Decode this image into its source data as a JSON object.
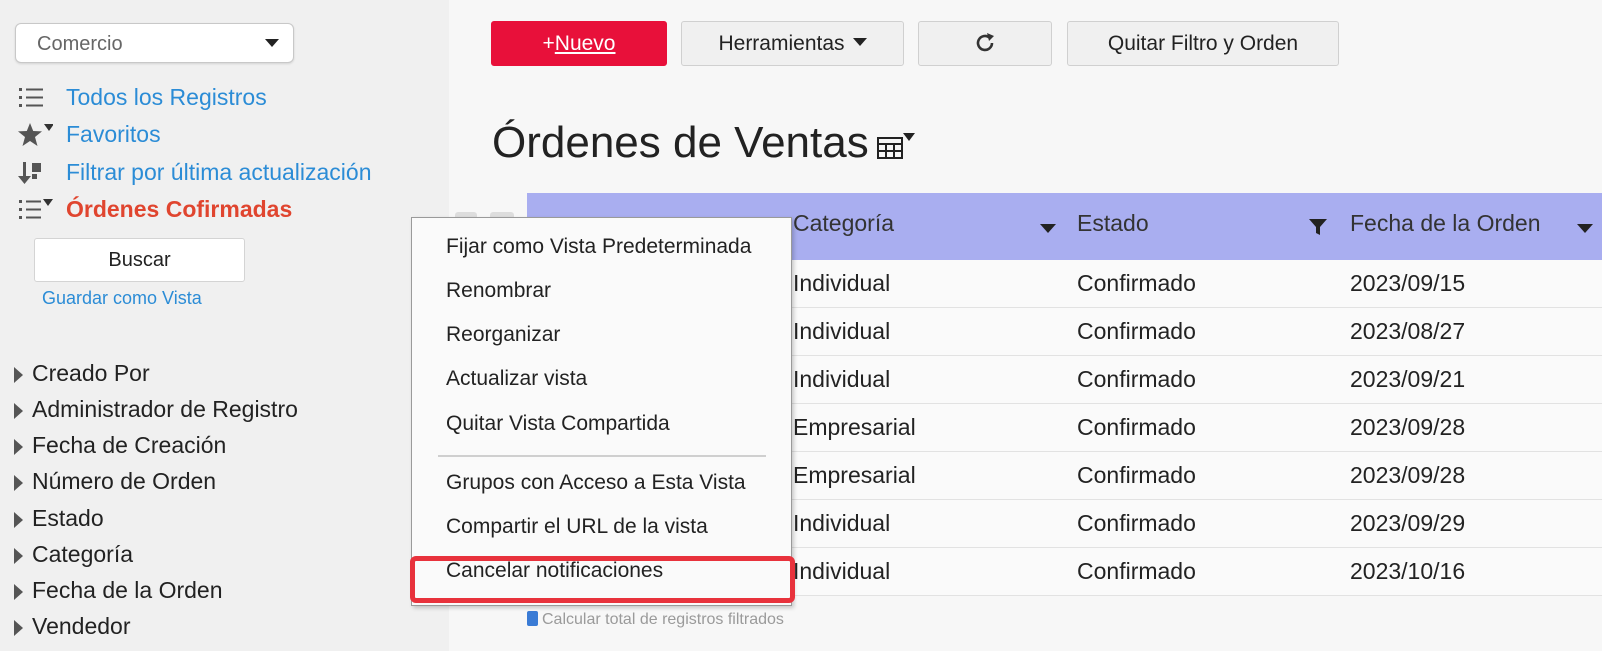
{
  "sidebar": {
    "app_select": "Comercio",
    "views": [
      {
        "label": "Todos los Registros",
        "icon": "list-icon"
      },
      {
        "label": "Favoritos",
        "icon": "star-filter-icon"
      },
      {
        "label": "Filtrar por última actualización",
        "icon": "sort-down-icon"
      },
      {
        "label": "Órdenes Cofirmadas",
        "icon": "list-filter-icon",
        "active": true
      }
    ],
    "search_label": "Buscar",
    "save_view_label": "Guardar como Vista",
    "fields": [
      "Creado Por",
      "Administrador de Registro",
      "Fecha de Creación",
      "Número de Orden",
      "Estado",
      "Categoría",
      "Fecha de la Orden",
      "Vendedor"
    ]
  },
  "toolbar": {
    "new_prefix": "+",
    "new_label": "Nuevo",
    "tools_label": "Herramientas",
    "refresh_icon": "refresh-icon",
    "clear_label": "Quitar Filtro y Orden"
  },
  "main": {
    "title": "Órdenes de Ventas",
    "view_switch_icon": "table-icon",
    "columns": [
      "Categoría",
      "Estado",
      "Fecha de la Orden"
    ],
    "rows": [
      [
        "Individual",
        "Confirmado",
        "2023/09/15"
      ],
      [
        "Individual",
        "Confirmado",
        "2023/08/27"
      ],
      [
        "Individual",
        "Confirmado",
        "2023/09/21"
      ],
      [
        "Empresarial",
        "Confirmado",
        "2023/09/28"
      ],
      [
        "Empresarial",
        "Confirmado",
        "2023/09/28"
      ],
      [
        "Individual",
        "Confirmado",
        "2023/09/29"
      ],
      [
        "Individual",
        "Confirmado",
        "2023/10/16"
      ]
    ],
    "calc_label": "Calcular total de registros filtrados"
  },
  "context_menu": {
    "items": [
      "Fijar como Vista Predeterminada",
      "Renombrar",
      "Reorganizar",
      "Actualizar vista",
      "Quitar Vista Compartida",
      "Grupos con Acceso a Esta Vista",
      "Compartir el URL de la vista",
      "Cancelar notificaciones"
    ],
    "highlighted_item": "Cancelar notificaciones",
    "highlight_color": "#e8323c"
  },
  "colors": {
    "accent_new": "#e8103a",
    "link": "#2b8cd6",
    "active_view": "#e0452f",
    "table_header": "#a9aef0"
  }
}
